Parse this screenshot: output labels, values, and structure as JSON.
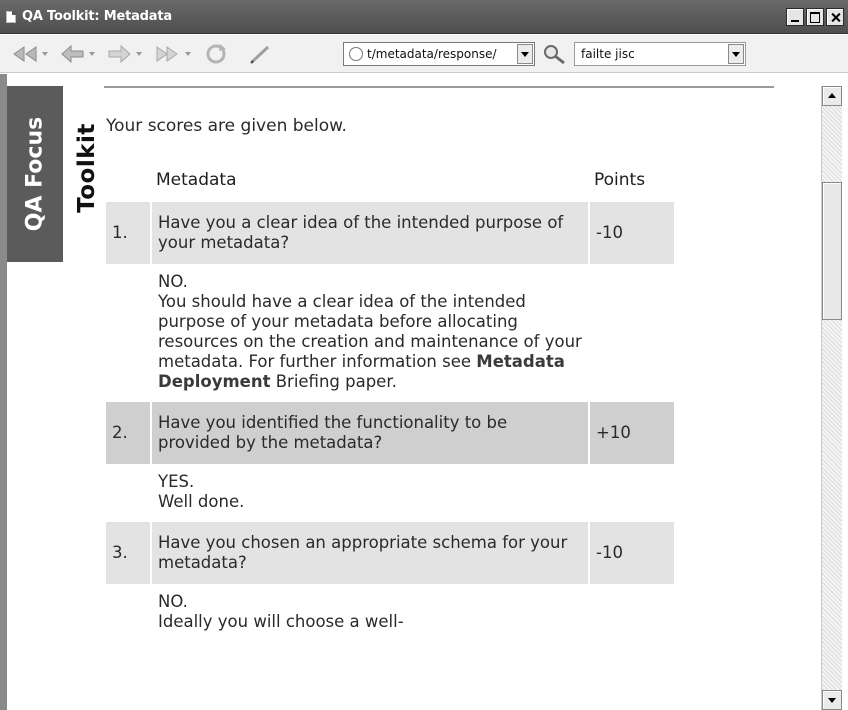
{
  "window": {
    "title": "QA Toolkit: Metadata"
  },
  "toolbar": {
    "back_icon": "back-double-arrow-icon",
    "address_value": "t/metadata/response/",
    "search_value": "failte jisc"
  },
  "banner": {
    "qa_focus": "QA Focus",
    "toolkit": "Toolkit"
  },
  "page": {
    "intro": "Your scores are given below.",
    "table": {
      "headers": {
        "question": "Metadata",
        "points": "Points"
      },
      "rows": [
        {
          "number": "1.",
          "question": "Have you a clear idea of the intended purpose of your metadata?",
          "points": "-10",
          "answer_head": "NO.",
          "answer_body": "You should have a clear idea of the intended purpose of your metadata before allocating resources on the creation and maintenance of your metadata. For further information see",
          "answer_link": "Metadata Deployment",
          "answer_tail": "Briefing paper."
        },
        {
          "number": "2.",
          "question": "Have you identified the functionality to be provided by the metadata?",
          "points": "+10",
          "answer_head": "YES.",
          "answer_body": "Well done."
        },
        {
          "number": "3.",
          "question": "Have you chosen an appropriate schema for your metadata?",
          "points": "-10",
          "answer_head": "NO.",
          "answer_body": "Ideally you will choose a well-"
        }
      ]
    }
  },
  "colors": {
    "title_bar": "#5a5a5a",
    "banner_bg": "#5b5b5b",
    "row_light": "#e3e3e3",
    "row_dark": "#cfcfcf"
  }
}
